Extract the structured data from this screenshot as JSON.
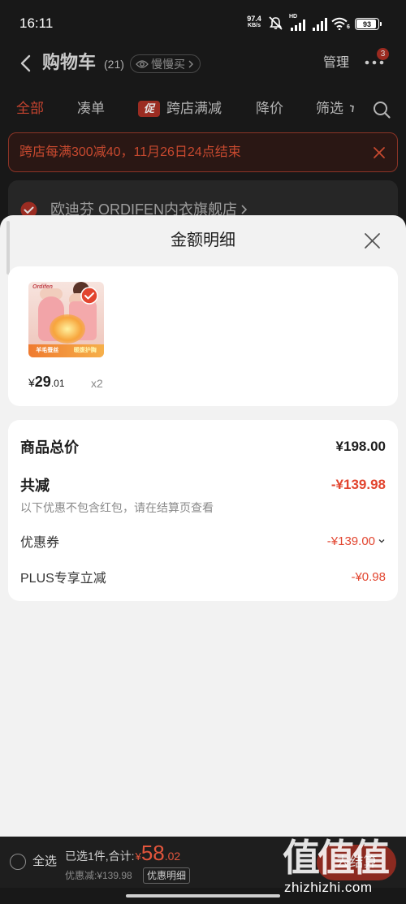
{
  "status_bar": {
    "time": "16:11",
    "net_speed_value": "97.4",
    "net_speed_unit": "KB/s",
    "signal_label": "HD",
    "wifi_gen": "6",
    "battery": "93",
    "icons": [
      "mute-bell-icon",
      "signal-icon",
      "signal-icon",
      "wifi-icon",
      "battery-icon"
    ]
  },
  "header": {
    "back_icon": "chevron-left-icon",
    "title": "购物车",
    "count": "(21)",
    "slow_buy_icon": "eye-icon",
    "slow_buy_label": "慢慢买",
    "manage_label": "管理",
    "more_icon": "more-dots-icon",
    "more_badge": "3"
  },
  "tabs": [
    {
      "label": "全部",
      "active": true
    },
    {
      "label": "凑单",
      "active": false
    },
    {
      "badge": "促",
      "label": "跨店满减",
      "active": false
    },
    {
      "label": "降价",
      "active": false
    },
    {
      "label": "筛选",
      "active": false,
      "icon": "filter-arrow-icon"
    }
  ],
  "search_icon": "search-icon",
  "promo_banner": {
    "text": "跨店每满300减40，11月26日24点结束",
    "close_icon": "close-icon"
  },
  "store": {
    "checked": true,
    "name": "欧迪芬 ORDIFEN内衣旗舰店",
    "icon": "chevron-right-icon"
  },
  "sheet": {
    "title": "金额明细",
    "close_icon": "close-icon",
    "product": {
      "checked": true,
      "image_brand": "Ordifen",
      "image_tag_1": "羊毛蚕丝",
      "image_tag_2": "暖腹护胸",
      "price_symbol": "¥",
      "price_int": "29",
      "price_dec": ".01",
      "quantity": "x2"
    },
    "summary": {
      "total_label": "商品总价",
      "total_value": "¥198.00",
      "reduction_label": "共减",
      "reduction_value": "-¥139.98",
      "note": "以下优惠不包含红包，请在结算页查看",
      "items": [
        {
          "label": "优惠券",
          "value": "-¥139.00",
          "expandable": true
        },
        {
          "label": "PLUS专享立减",
          "value": "-¥0.98",
          "expandable": false
        }
      ]
    }
  },
  "bottom_bar": {
    "select_all_label": "全选",
    "select_all_checked": false,
    "selected_text": "已选1件,合计:",
    "total_symbol": "¥",
    "total_int": "58",
    "total_dec": ".02",
    "discount_text": "优惠减:¥139.98",
    "detail_button": "优惠明细",
    "checkout_button": "去结算"
  },
  "watermark": {
    "logo_text": "值值值",
    "site": "zhizhizhi.com"
  },
  "colors": {
    "accent_red": "#e2452f",
    "dim_accent_red": "#c4432f",
    "sheet_background": "#f2f2f2",
    "card_background": "#ffffff",
    "overlay_background": "#181818"
  }
}
